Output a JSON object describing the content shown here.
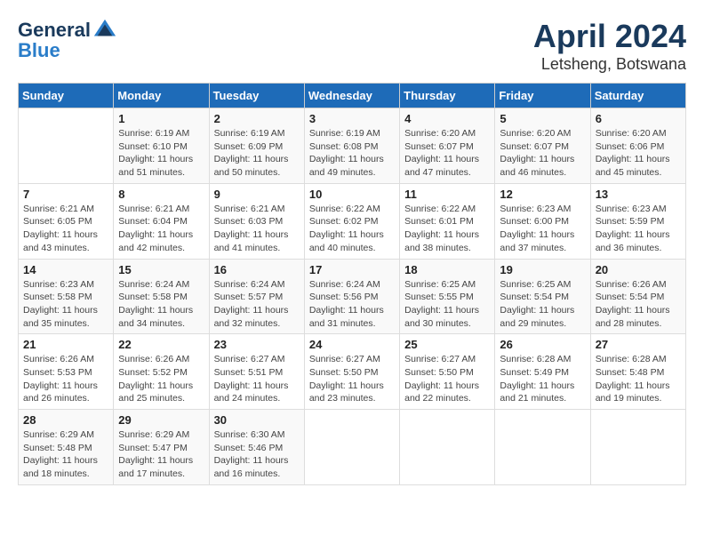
{
  "header": {
    "logo_general": "General",
    "logo_blue": "Blue",
    "title": "April 2024",
    "location": "Letsheng, Botswana"
  },
  "days_of_week": [
    "Sunday",
    "Monday",
    "Tuesday",
    "Wednesday",
    "Thursday",
    "Friday",
    "Saturday"
  ],
  "weeks": [
    [
      {
        "num": "",
        "detail": ""
      },
      {
        "num": "1",
        "detail": "Sunrise: 6:19 AM\nSunset: 6:10 PM\nDaylight: 11 hours\nand 51 minutes."
      },
      {
        "num": "2",
        "detail": "Sunrise: 6:19 AM\nSunset: 6:09 PM\nDaylight: 11 hours\nand 50 minutes."
      },
      {
        "num": "3",
        "detail": "Sunrise: 6:19 AM\nSunset: 6:08 PM\nDaylight: 11 hours\nand 49 minutes."
      },
      {
        "num": "4",
        "detail": "Sunrise: 6:20 AM\nSunset: 6:07 PM\nDaylight: 11 hours\nand 47 minutes."
      },
      {
        "num": "5",
        "detail": "Sunrise: 6:20 AM\nSunset: 6:07 PM\nDaylight: 11 hours\nand 46 minutes."
      },
      {
        "num": "6",
        "detail": "Sunrise: 6:20 AM\nSunset: 6:06 PM\nDaylight: 11 hours\nand 45 minutes."
      }
    ],
    [
      {
        "num": "7",
        "detail": "Sunrise: 6:21 AM\nSunset: 6:05 PM\nDaylight: 11 hours\nand 43 minutes."
      },
      {
        "num": "8",
        "detail": "Sunrise: 6:21 AM\nSunset: 6:04 PM\nDaylight: 11 hours\nand 42 minutes."
      },
      {
        "num": "9",
        "detail": "Sunrise: 6:21 AM\nSunset: 6:03 PM\nDaylight: 11 hours\nand 41 minutes."
      },
      {
        "num": "10",
        "detail": "Sunrise: 6:22 AM\nSunset: 6:02 PM\nDaylight: 11 hours\nand 40 minutes."
      },
      {
        "num": "11",
        "detail": "Sunrise: 6:22 AM\nSunset: 6:01 PM\nDaylight: 11 hours\nand 38 minutes."
      },
      {
        "num": "12",
        "detail": "Sunrise: 6:23 AM\nSunset: 6:00 PM\nDaylight: 11 hours\nand 37 minutes."
      },
      {
        "num": "13",
        "detail": "Sunrise: 6:23 AM\nSunset: 5:59 PM\nDaylight: 11 hours\nand 36 minutes."
      }
    ],
    [
      {
        "num": "14",
        "detail": "Sunrise: 6:23 AM\nSunset: 5:58 PM\nDaylight: 11 hours\nand 35 minutes."
      },
      {
        "num": "15",
        "detail": "Sunrise: 6:24 AM\nSunset: 5:58 PM\nDaylight: 11 hours\nand 34 minutes."
      },
      {
        "num": "16",
        "detail": "Sunrise: 6:24 AM\nSunset: 5:57 PM\nDaylight: 11 hours\nand 32 minutes."
      },
      {
        "num": "17",
        "detail": "Sunrise: 6:24 AM\nSunset: 5:56 PM\nDaylight: 11 hours\nand 31 minutes."
      },
      {
        "num": "18",
        "detail": "Sunrise: 6:25 AM\nSunset: 5:55 PM\nDaylight: 11 hours\nand 30 minutes."
      },
      {
        "num": "19",
        "detail": "Sunrise: 6:25 AM\nSunset: 5:54 PM\nDaylight: 11 hours\nand 29 minutes."
      },
      {
        "num": "20",
        "detail": "Sunrise: 6:26 AM\nSunset: 5:54 PM\nDaylight: 11 hours\nand 28 minutes."
      }
    ],
    [
      {
        "num": "21",
        "detail": "Sunrise: 6:26 AM\nSunset: 5:53 PM\nDaylight: 11 hours\nand 26 minutes."
      },
      {
        "num": "22",
        "detail": "Sunrise: 6:26 AM\nSunset: 5:52 PM\nDaylight: 11 hours\nand 25 minutes."
      },
      {
        "num": "23",
        "detail": "Sunrise: 6:27 AM\nSunset: 5:51 PM\nDaylight: 11 hours\nand 24 minutes."
      },
      {
        "num": "24",
        "detail": "Sunrise: 6:27 AM\nSunset: 5:50 PM\nDaylight: 11 hours\nand 23 minutes."
      },
      {
        "num": "25",
        "detail": "Sunrise: 6:27 AM\nSunset: 5:50 PM\nDaylight: 11 hours\nand 22 minutes."
      },
      {
        "num": "26",
        "detail": "Sunrise: 6:28 AM\nSunset: 5:49 PM\nDaylight: 11 hours\nand 21 minutes."
      },
      {
        "num": "27",
        "detail": "Sunrise: 6:28 AM\nSunset: 5:48 PM\nDaylight: 11 hours\nand 19 minutes."
      }
    ],
    [
      {
        "num": "28",
        "detail": "Sunrise: 6:29 AM\nSunset: 5:48 PM\nDaylight: 11 hours\nand 18 minutes."
      },
      {
        "num": "29",
        "detail": "Sunrise: 6:29 AM\nSunset: 5:47 PM\nDaylight: 11 hours\nand 17 minutes."
      },
      {
        "num": "30",
        "detail": "Sunrise: 6:30 AM\nSunset: 5:46 PM\nDaylight: 11 hours\nand 16 minutes."
      },
      {
        "num": "",
        "detail": ""
      },
      {
        "num": "",
        "detail": ""
      },
      {
        "num": "",
        "detail": ""
      },
      {
        "num": "",
        "detail": ""
      }
    ]
  ]
}
